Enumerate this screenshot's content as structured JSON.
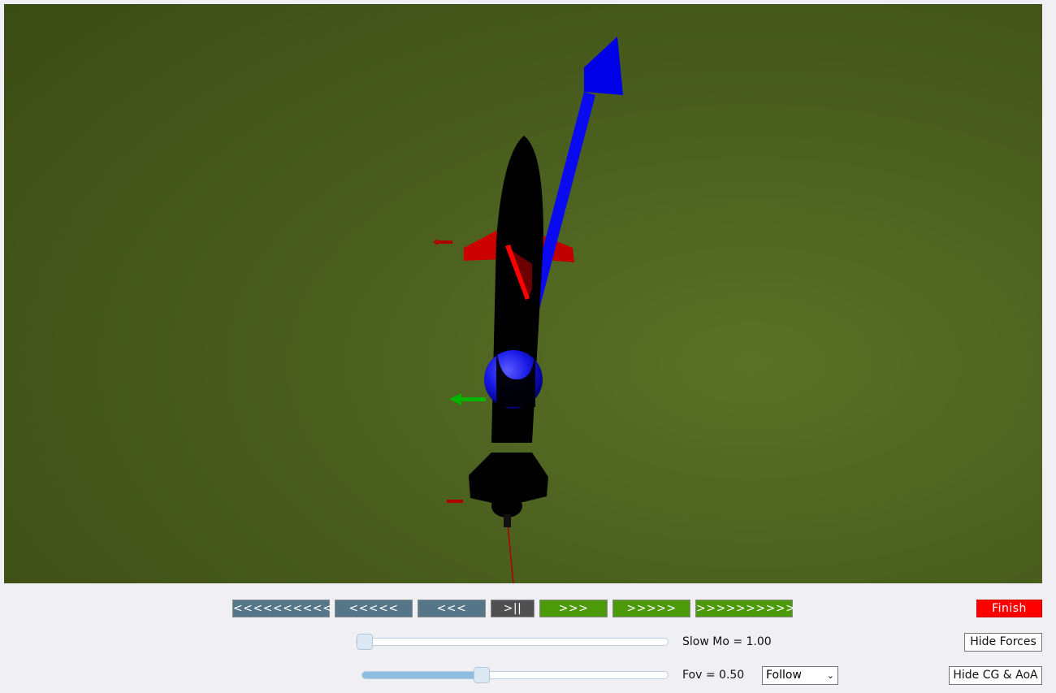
{
  "scene": {
    "objects": [
      "rocket-body",
      "cg-marker-sphere",
      "velocity-vector-arrow",
      "force-arrows",
      "trajectory-line"
    ],
    "colors": {
      "ground": "#4a5e1e",
      "rocket": "#000000",
      "cg_sphere": "#1a1aff",
      "velocity_arrow": "#0000ee",
      "fins_forces": "#cc0000",
      "side_force": "#00b000"
    }
  },
  "controls": {
    "rew_10": "<<<<<<<<<<",
    "rew_5": "<<<<<",
    "rew_3": "<<<",
    "play_pause": ">||",
    "fwd_3": ">>>",
    "fwd_5": ">>>>>",
    "fwd_10": ">>>>>>>>>>",
    "finish": "Finish"
  },
  "slowmo": {
    "label": "Slow Mo = 1.00",
    "value": 1.0,
    "position_fraction": 0.0
  },
  "fov": {
    "label": "Fov = 0.50",
    "value": 0.5,
    "position_fraction": 0.39
  },
  "camera_mode": {
    "selected": "Follow"
  },
  "toggles": {
    "hide_forces": "Hide Forces",
    "hide_cg_aoa": "Hide CG & AoA"
  }
}
